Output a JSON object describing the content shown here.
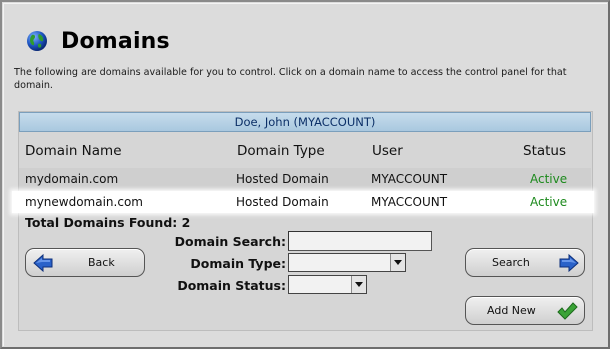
{
  "header": {
    "title": "Domains",
    "intro": "The following are domains available for you to control. Click on a domain name to access the control panel for that domain."
  },
  "account": {
    "label": "Doe, John (MYACCOUNT)"
  },
  "table": {
    "columns": [
      "Domain Name",
      "Domain Type",
      "User",
      "Status"
    ],
    "rows": [
      {
        "domain": "mydomain.com",
        "type": "Hosted Domain",
        "user": "MYACCOUNT",
        "status": "Active"
      },
      {
        "domain": "mynewdomain.com",
        "type": "Hosted Domain",
        "user": "MYACCOUNT",
        "status": "Active"
      }
    ]
  },
  "summary": {
    "total_label": "Total Domains Found: 2"
  },
  "search_form": {
    "domain_search_label": "Domain Search:",
    "domain_search_value": "",
    "domain_type_label": "Domain Type:",
    "domain_type_value": "",
    "domain_status_label": "Domain Status:",
    "domain_status_value": ""
  },
  "buttons": {
    "back": "Back",
    "search": "Search",
    "add_new": "Add New"
  },
  "icons": {
    "title_icon": "globe-icon",
    "back_icon": "arrow-left-icon",
    "search_icon": "arrow-right-icon",
    "add_icon": "checkmark-icon"
  },
  "colors": {
    "status_active": "#1d8a1d",
    "account_bar": "#b5d0e4",
    "account_text": "#0b2f67",
    "arrow_blue": "#2a62c9",
    "check_green": "#3aa336"
  }
}
